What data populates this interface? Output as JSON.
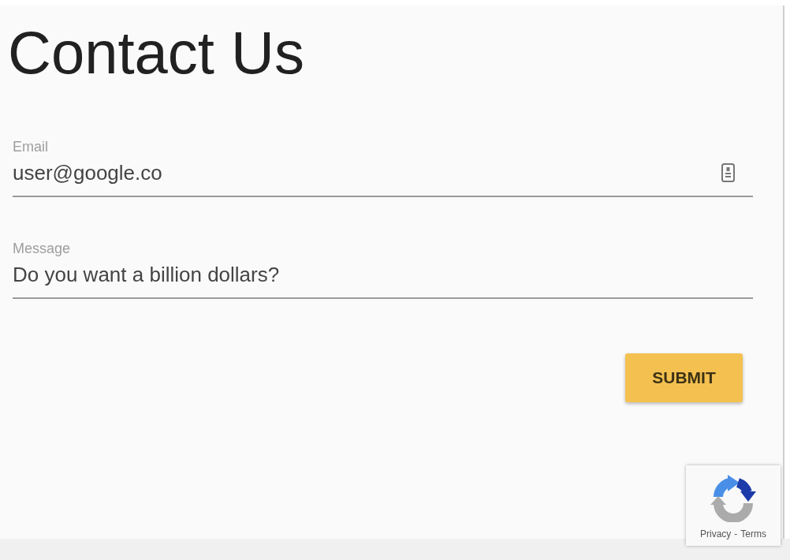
{
  "title": "Contact Us",
  "fields": [
    {
      "kind": "email",
      "label": "Email",
      "value": "user@google.co"
    },
    {
      "kind": "text",
      "label": "Message",
      "value": "Do you want a billion dollars?"
    }
  ],
  "submit_button": {
    "label": "SUBMIT"
  },
  "recaptcha_badge": {
    "links": [
      "Privacy",
      "Terms"
    ],
    "separator": "-"
  }
}
